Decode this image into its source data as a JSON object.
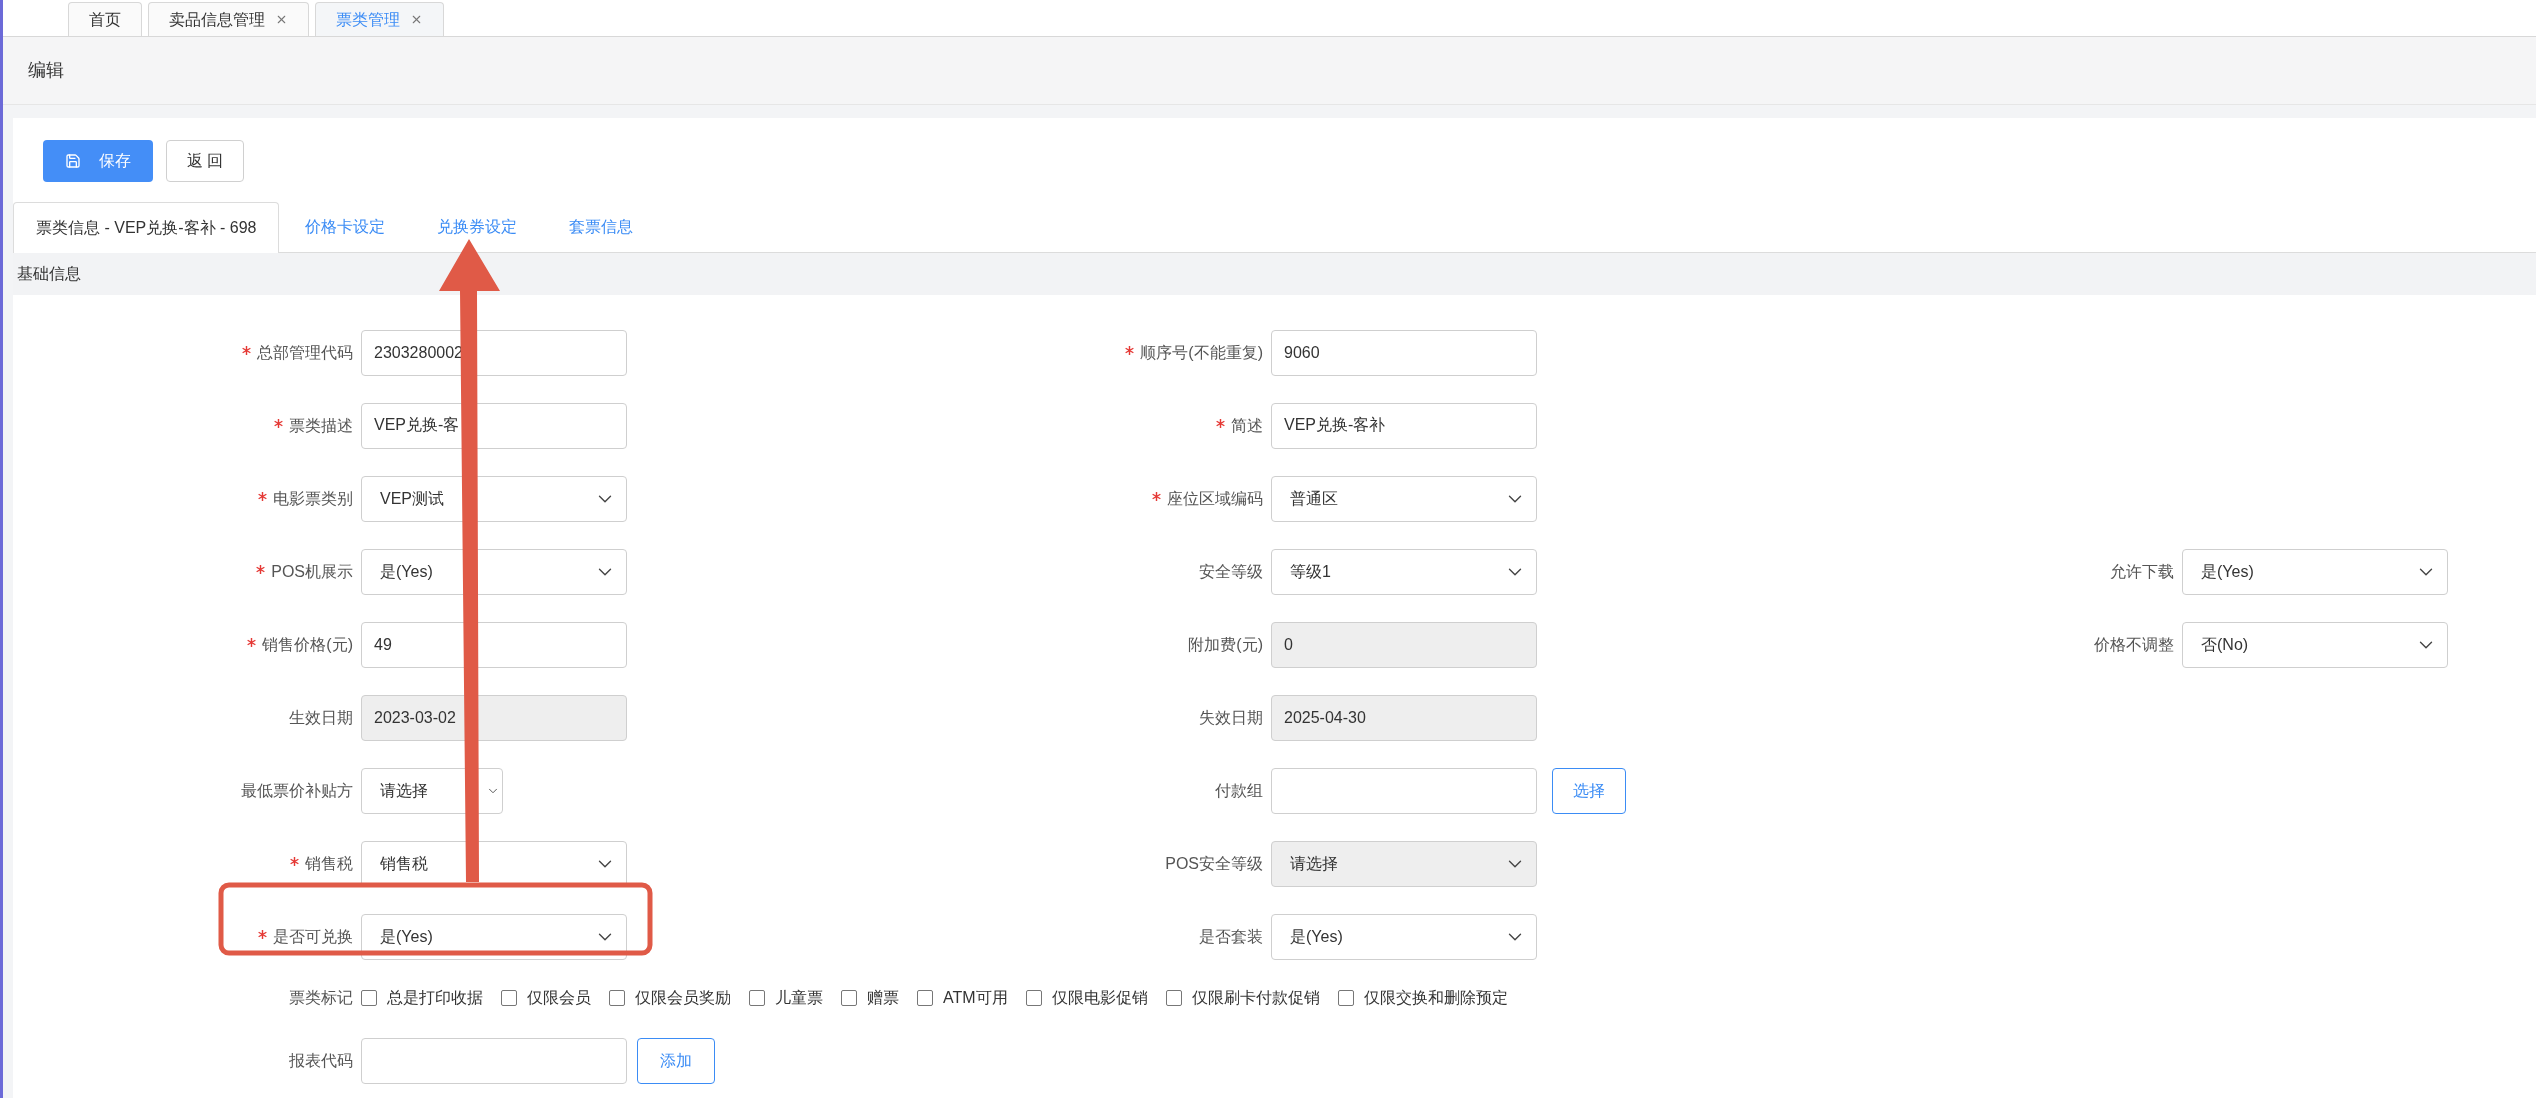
{
  "top_tabs": [
    {
      "label": "首页",
      "closable": false,
      "selected": false
    },
    {
      "label": "卖品信息管理",
      "closable": true,
      "selected": false
    },
    {
      "label": "票类管理",
      "closable": true,
      "selected": true
    }
  ],
  "page_title": "编辑",
  "buttons": [
    {
      "label": "保存",
      "kind": "primary"
    },
    {
      "label": "返 回",
      "kind": "default"
    }
  ],
  "tabs": [
    {
      "label": "票类信息 - VEP兑换-客补 - 698",
      "selected": true
    },
    {
      "label": "价格卡设定",
      "selected": false
    },
    {
      "label": "兑换券设定",
      "selected": false
    },
    {
      "label": "套票信息",
      "selected": false
    }
  ],
  "section_title": "基础信息",
  "form_rows": [
    [
      {
        "label": "总部管理代码",
        "required": true,
        "kind": "input",
        "value": "2303280002",
        "disabled": false
      },
      {
        "label": "顺序号(不能重复)",
        "required": true,
        "kind": "input",
        "value": "9060",
        "disabled": false
      },
      {
        "kind": "empty"
      }
    ],
    [
      {
        "label": "票类描述",
        "required": true,
        "kind": "input",
        "value": "VEP兑换-客",
        "disabled": false
      },
      {
        "label": "简述",
        "required": true,
        "kind": "input",
        "value": "VEP兑换-客补",
        "disabled": false
      },
      {
        "kind": "empty"
      }
    ],
    [
      {
        "label": "电影票类别",
        "required": true,
        "kind": "select",
        "value": "VEP测试",
        "disabled": false
      },
      {
        "label": "座位区域编码",
        "required": true,
        "kind": "select",
        "value": "普通区",
        "disabled": false
      },
      {
        "kind": "empty"
      }
    ],
    [
      {
        "label": "POS机展示",
        "required": true,
        "kind": "select",
        "value": "是(Yes)",
        "disabled": false
      },
      {
        "label": "安全等级",
        "required": false,
        "kind": "select",
        "value": "等级1",
        "disabled": false
      },
      {
        "label": "允许下载",
        "required": false,
        "kind": "select",
        "value": "是(Yes)",
        "disabled": false
      }
    ],
    [
      {
        "label": "销售价格(元)",
        "required": true,
        "kind": "input",
        "value": "49",
        "disabled": false
      },
      {
        "label": "附加费(元)",
        "required": false,
        "kind": "input",
        "value": "0",
        "disabled": true
      },
      {
        "label": "价格不调整",
        "required": false,
        "kind": "select",
        "value": "否(No)",
        "disabled": false
      }
    ],
    [
      {
        "label": "生效日期",
        "required": false,
        "kind": "input",
        "value": "2023-03-02",
        "disabled": true
      },
      {
        "label": "失效日期",
        "required": false,
        "kind": "input",
        "value": "2025-04-30",
        "disabled": true
      },
      {
        "kind": "empty"
      }
    ],
    [
      {
        "label": "最低票价补贴方",
        "required": false,
        "kind": "short_select",
        "value": "请选择",
        "disabled": false
      },
      {
        "label": "付款组",
        "required": false,
        "kind": "input",
        "disabled": false,
        "button": "选择"
      },
      {
        "kind": "empty"
      }
    ],
    [
      {
        "label": "销售税",
        "required": true,
        "kind": "select",
        "value": "销售税",
        "disabled": false
      },
      {
        "label": "POS安全等级",
        "required": false,
        "kind": "select",
        "value": "请选择",
        "disabled": true
      },
      {
        "kind": "empty"
      }
    ],
    [
      {
        "label": "是否可兑换",
        "required": true,
        "kind": "select",
        "value": "是(Yes)",
        "disabled": false
      },
      {
        "label": "是否套装",
        "required": false,
        "kind": "select",
        "value": "是(Yes)",
        "disabled": false
      },
      {
        "kind": "empty"
      }
    ]
  ],
  "ticket_flags": {
    "label": "票类标记",
    "options": [
      {
        "label": "总是打印收据",
        "checked": false
      },
      {
        "label": "仅限会员",
        "checked": false
      },
      {
        "label": "仅限会员奖励",
        "checked": false
      },
      {
        "label": "儿童票",
        "checked": false
      },
      {
        "label": "赠票",
        "checked": false
      },
      {
        "label": "ATM可用",
        "checked": false
      },
      {
        "label": "仅限电影促销",
        "checked": false
      },
      {
        "label": "仅限刷卡付款促销",
        "checked": false
      },
      {
        "label": "仅限交换和删除预定",
        "checked": false
      }
    ]
  },
  "report_code": {
    "label": "报表代码",
    "button": "添加"
  }
}
